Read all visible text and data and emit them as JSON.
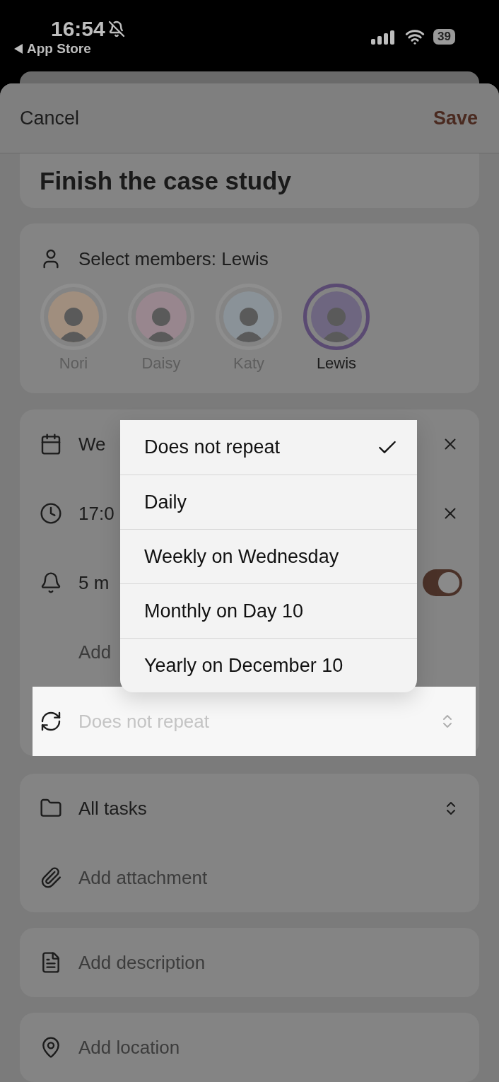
{
  "status_bar": {
    "time": "16:54",
    "back_label": "App Store",
    "battery": "39"
  },
  "header": {
    "cancel": "Cancel",
    "save": "Save"
  },
  "title": "Finish the case study",
  "members": {
    "label": "Select members: Lewis",
    "people": [
      {
        "name": "Nori",
        "selected": false,
        "color": "#a08e7e"
      },
      {
        "name": "Daisy",
        "selected": false,
        "color": "#98868e"
      },
      {
        "name": "Katy",
        "selected": false,
        "color": "#8a9298"
      },
      {
        "name": "Lewis",
        "selected": true,
        "color": "#6e6680"
      }
    ]
  },
  "schedule": [
    {
      "kind": "date",
      "text": "We"
    },
    {
      "kind": "time",
      "text": "17:0"
    },
    {
      "kind": "reminder",
      "text": "5 m",
      "on": true
    },
    {
      "kind": "add",
      "text": "Add"
    },
    {
      "kind": "repeat",
      "placeholder": "Does not repeat"
    }
  ],
  "repeat_menu": [
    {
      "label": "Does not repeat",
      "selected": true
    },
    {
      "label": "Daily",
      "selected": false
    },
    {
      "label": "Weekly on Wednesday",
      "selected": false
    },
    {
      "label": "Monthly on Day 10",
      "selected": false
    },
    {
      "label": "Yearly on December 10",
      "selected": false
    }
  ],
  "organize": [
    {
      "kind": "list",
      "label": "All tasks"
    },
    {
      "kind": "attachment",
      "label": "Add attachment"
    }
  ],
  "description": {
    "label": "Add description"
  },
  "location": {
    "label": "Add location"
  }
}
